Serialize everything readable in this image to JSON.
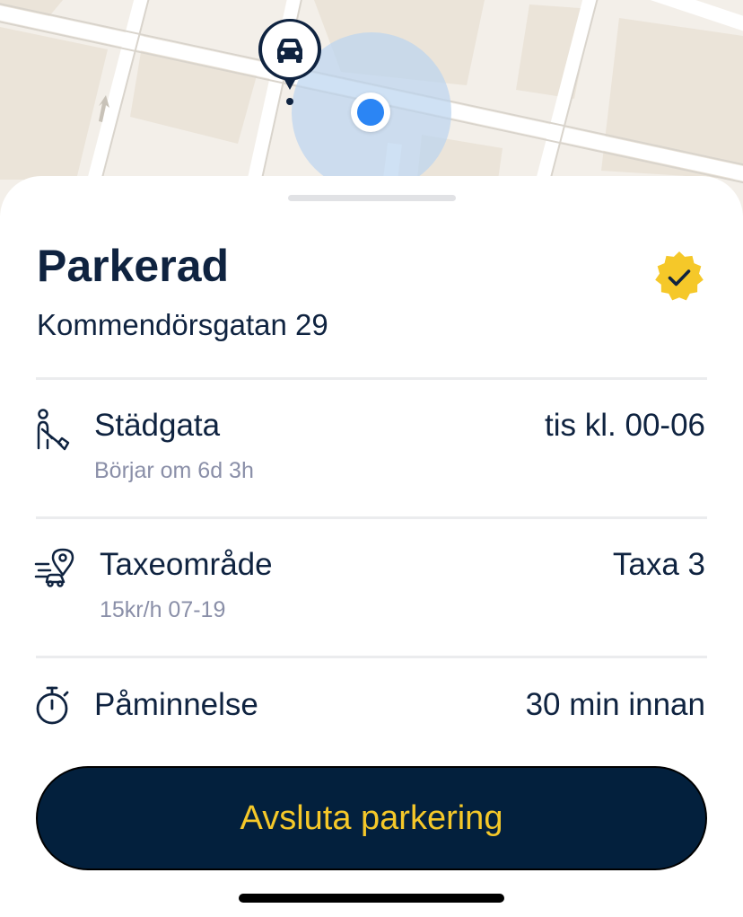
{
  "map": {
    "parked_pin_icon": "car-icon",
    "user_location_icon": "location-dot-icon",
    "colors": {
      "land": "#f3efe9",
      "block": "#ebe4d9",
      "road": "#ffffff",
      "accuracy": "#cfe0f3",
      "location": "#2b85f4"
    }
  },
  "status": {
    "title": "Parkerad",
    "address": "Kommendörsgatan 29",
    "badge_icon": "verified-check-icon",
    "badge_color": "#f5c829"
  },
  "details": [
    {
      "icon": "street-cleaning-icon",
      "title": "Städgata",
      "subtitle": "Börjar om 6d 3h",
      "value": "tis kl. 00-06"
    },
    {
      "icon": "tariff-area-icon",
      "title": "Taxeområde",
      "subtitle": "15kr/h 07-19",
      "value": "Taxa 3"
    },
    {
      "icon": "stopwatch-icon",
      "title": "Påminnelse",
      "value": "30 min innan"
    }
  ],
  "actions": {
    "end_label": "Avsluta parkering",
    "button_color": "#03203d",
    "label_color": "#f5c829"
  }
}
